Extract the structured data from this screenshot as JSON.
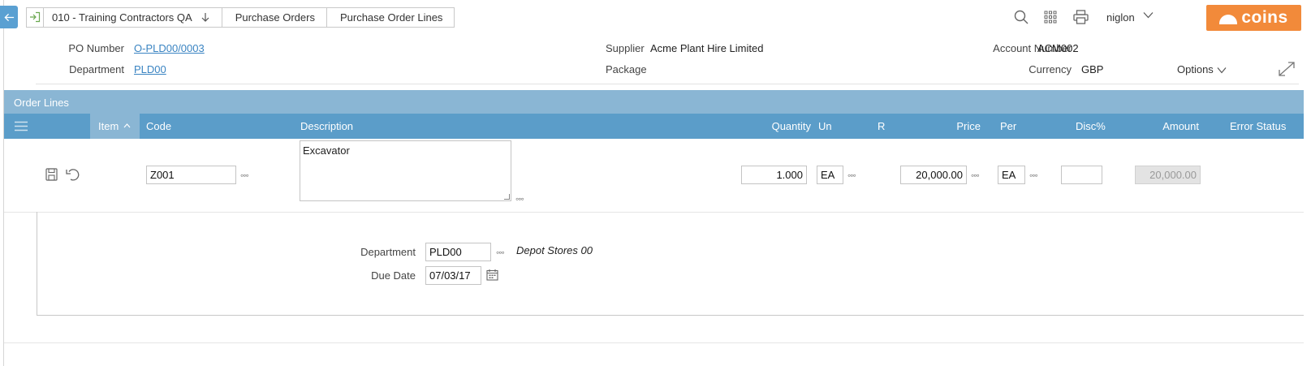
{
  "breadcrumb": {
    "company": "010 - Training Contractors QA",
    "items": [
      "Purchase Orders",
      "Purchase Order Lines"
    ]
  },
  "user": {
    "name": "niglon"
  },
  "logo": {
    "text": "coins"
  },
  "header": {
    "po_number_label": "PO Number",
    "po_number": "O-PLD00/0003",
    "department_label": "Department",
    "department": "PLD00",
    "supplier_label": "Supplier",
    "supplier": "Acme Plant Hire Limited",
    "package_label": "Package",
    "package": "",
    "account_number_label": "Account Number",
    "account_number": "ACM002",
    "currency_label": "Currency",
    "currency": "GBP",
    "options_label": "Options"
  },
  "order_lines": {
    "section_title": "Order Lines",
    "columns": {
      "item": "Item",
      "code": "Code",
      "description": "Description",
      "quantity": "Quantity",
      "unit": "Un",
      "r": "R",
      "price": "Price",
      "per": "Per",
      "disc": "Disc%",
      "amount": "Amount",
      "error_status": "Error Status"
    },
    "row": {
      "code": "Z001",
      "description": "Excavator",
      "quantity": "1.000",
      "unit": "EA",
      "price": "20,000.00",
      "per": "EA",
      "disc": "",
      "amount": "20,000.00"
    },
    "detail": {
      "department_label": "Department",
      "department": "PLD00",
      "department_name": "Depot Stores 00",
      "due_date_label": "Due Date",
      "due_date": "07/03/17"
    }
  },
  "colors": {
    "accent": "#5b9dc9",
    "section": "#8ab6d4",
    "brand": "#f28a3a",
    "link": "#3a84c2"
  }
}
